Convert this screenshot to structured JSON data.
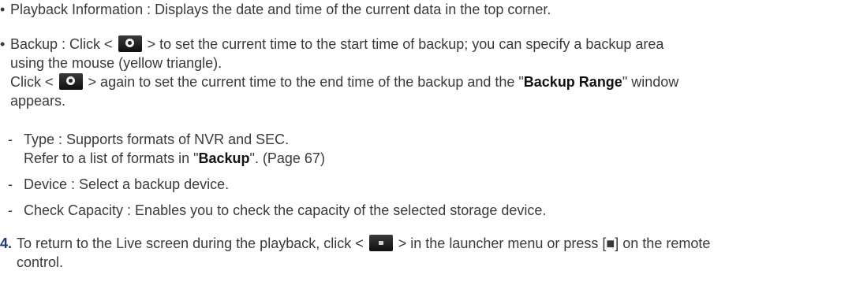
{
  "bullets": {
    "playback": "Playback Information : Displays the date and time of the current data in the top corner.",
    "backup_line1_a": "Backup : Click <",
    "backup_line1_b": "> to set the current time to the start time of backup; you can specify a backup area",
    "backup_line2": "using the mouse (yellow triangle).",
    "backup_line3_a": "Click <",
    "backup_line3_b": "> again to set the current time to the end time of the backup and the \"",
    "backup_range": "Backup Range",
    "backup_line3_c": "\" window",
    "backup_line4": "appears."
  },
  "sub_items": {
    "type_line1": "Type : Supports formats of NVR and SEC.",
    "type_line2_a": "Refer to a list of formats in \"",
    "type_backup": "Backup",
    "type_line2_b": "\". (Page 67)",
    "device": "Device : Select a backup device.",
    "capacity": "Check Capacity : Enables you to check the capacity of the selected storage device."
  },
  "step4": {
    "number": "4.",
    "line1_a": "To return to the Live screen during the playback, click <",
    "line1_b": "> in the launcher menu or press [■] on the remote",
    "line2": "control."
  },
  "icons": {
    "backup_icon": "backup-record-icon",
    "stop_icon": "stop-icon",
    "accent": "#1f3a78"
  }
}
